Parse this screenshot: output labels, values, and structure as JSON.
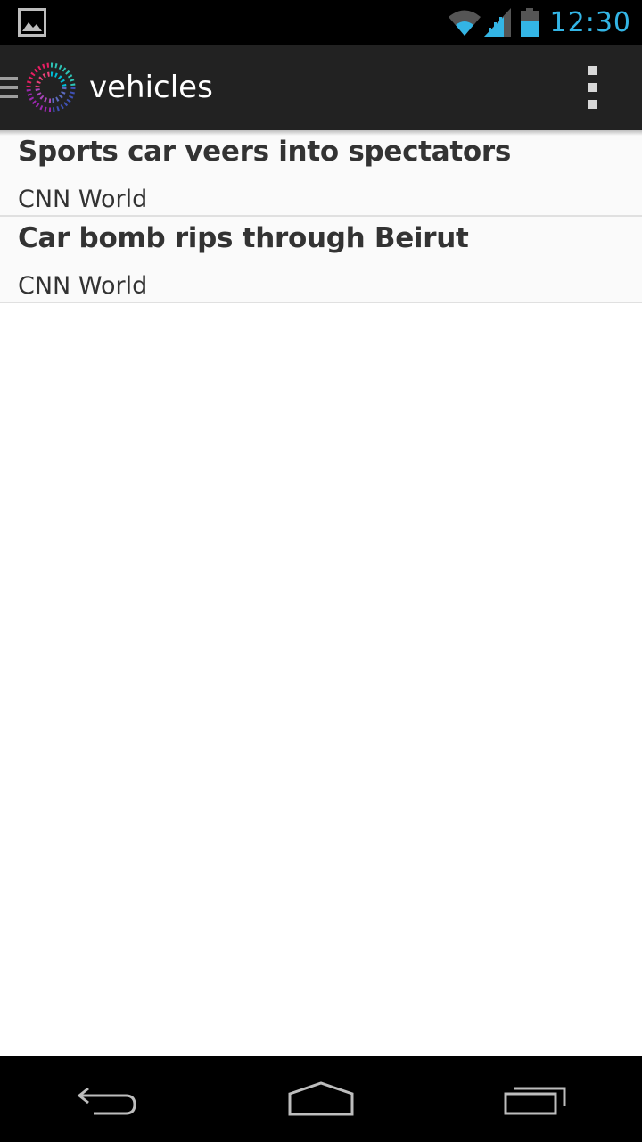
{
  "status_bar": {
    "time": "12:30",
    "icons": [
      "gallery-icon",
      "wifi-icon",
      "signal-icon",
      "battery-icon"
    ],
    "accent_color": "#33b5e5"
  },
  "action_bar": {
    "title": "vehicles",
    "icons": [
      "drawer-icon",
      "app-logo-icon",
      "overflow-menu-icon"
    ]
  },
  "news_items": [
    {
      "title": "Sports car veers into spectators",
      "source": "CNN World"
    },
    {
      "title": "Car bomb rips through Beirut",
      "source": "CNN World"
    }
  ],
  "nav_bar": {
    "icons": [
      "back-icon",
      "home-icon",
      "recent-apps-icon"
    ]
  }
}
